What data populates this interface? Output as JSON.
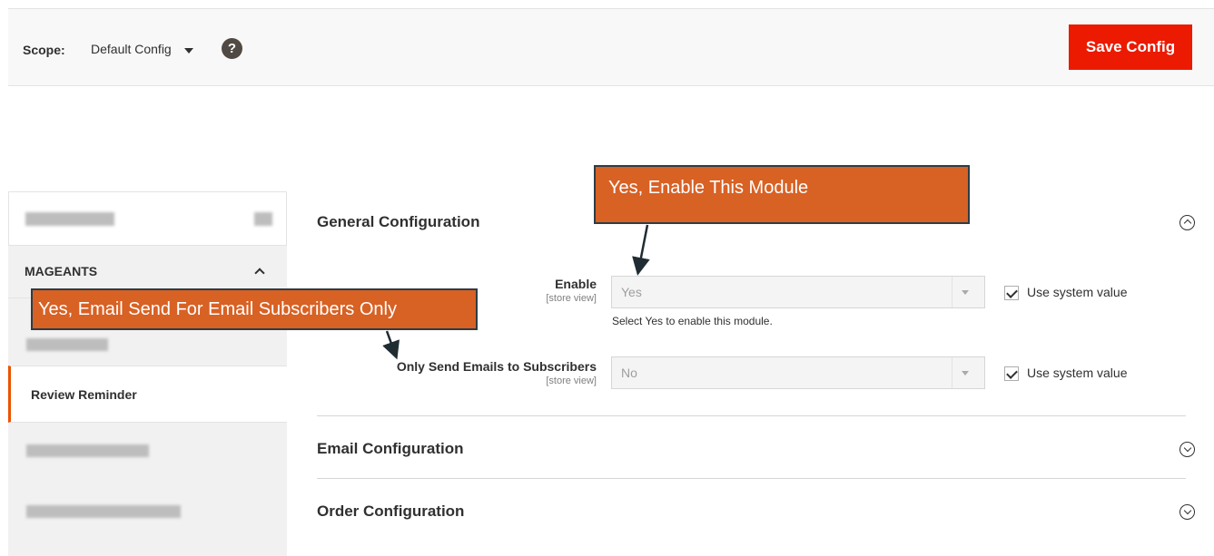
{
  "header": {
    "scope_label": "Scope:",
    "scope_value": "Default Config",
    "help_icon": "question-circle-icon",
    "save_label": "Save Config"
  },
  "sidebar": {
    "section_title": "MAGEANTS",
    "active_item": "Review Reminder"
  },
  "sections": [
    {
      "title": "General Configuration",
      "expanded": true
    },
    {
      "title": "Email Configuration",
      "expanded": false
    },
    {
      "title": "Order Configuration",
      "expanded": false
    }
  ],
  "fields": {
    "enable": {
      "label": "Enable",
      "scope": "[store view]",
      "value": "Yes",
      "note": "Select Yes to enable this module.",
      "use_system_value": "Use system value",
      "use_system_checked": true
    },
    "subscribers": {
      "label": "Only Send Emails to Subscribers",
      "scope": "[store view]",
      "value": "No",
      "use_system_value": "Use system value",
      "use_system_checked": true
    }
  },
  "annotations": {
    "enable_callout": "Yes, Enable This Module",
    "subscribers_callout": "Yes, Email Send For Email Subscribers Only"
  },
  "colors": {
    "save_button": "#eb1a00",
    "callout_fill": "#d86124",
    "callout_border": "#2d3d45",
    "active_accent": "#eb5202"
  }
}
